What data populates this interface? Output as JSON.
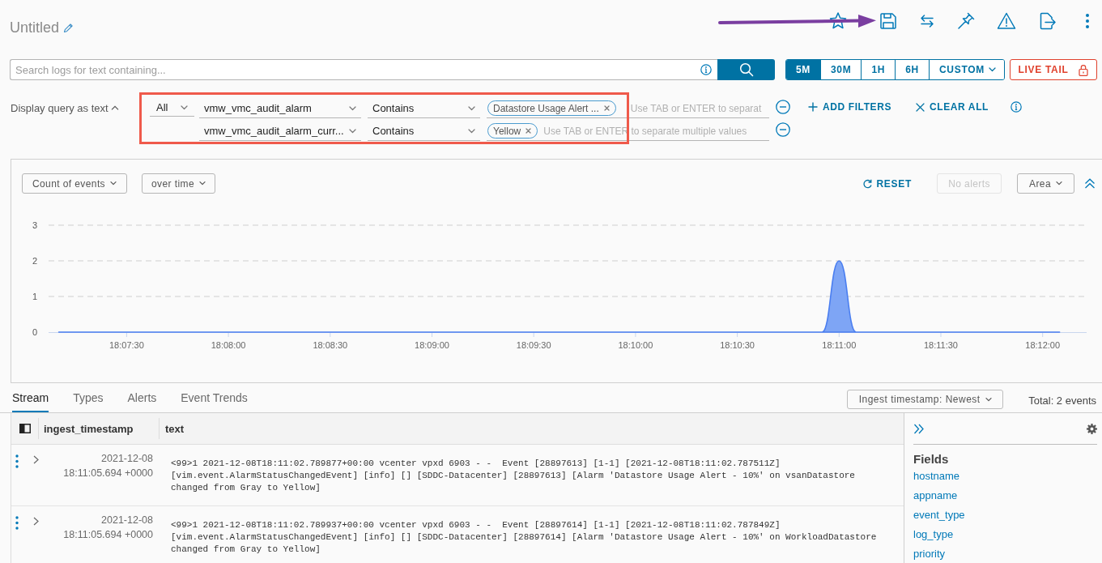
{
  "page": {
    "title": "Untitled"
  },
  "search": {
    "placeholder": "Search logs for text containing..."
  },
  "time_ranges": [
    {
      "label": "5M",
      "kind": "preset",
      "selected": true
    },
    {
      "label": "30M",
      "kind": "preset",
      "selected": false
    },
    {
      "label": "1H",
      "kind": "preset",
      "selected": false
    },
    {
      "label": "6H",
      "kind": "preset",
      "selected": false
    },
    {
      "label": "CUSTOM",
      "kind": "dropdown",
      "selected": false
    }
  ],
  "live_tail": {
    "label": "LIVE TAIL"
  },
  "query": {
    "toggle_label": "Display query as text",
    "expanded": true,
    "match": "All",
    "filters": [
      {
        "field": "vmw_vmc_audit_alarm",
        "operator": "Contains",
        "values": [
          "Datastore Usage Alert ..."
        ],
        "placeholder": "Use TAB or ENTER to separat"
      },
      {
        "field": "vmw_vmc_audit_alarm_curr...",
        "operator": "Contains",
        "values": [
          "Yellow"
        ],
        "placeholder": "Use TAB or ENTER to separate multiple values"
      }
    ],
    "actions": [
      {
        "kind": "add",
        "label": "ADD FILTERS"
      },
      {
        "kind": "clear",
        "label": "CLEAR ALL"
      }
    ]
  },
  "chart_panel": {
    "metric": "Count of events",
    "grouping": "over time",
    "reset_label": "RESET",
    "alerts": {
      "label": "No alerts",
      "disabled": true
    },
    "chart_type": "Area",
    "chart_data": {
      "type": "area",
      "categories": [
        null,
        null,
        null,
        null,
        "18:07:30",
        null,
        null,
        null,
        null,
        null,
        "18:08:00",
        null,
        null,
        null,
        null,
        null,
        "18:08:30",
        null,
        null,
        null,
        null,
        null,
        "18:09:00",
        null,
        null,
        null,
        null,
        null,
        "18:09:30",
        null,
        null,
        null,
        null,
        null,
        "18:10:00",
        null,
        null,
        null,
        null,
        null,
        "18:10:30",
        null,
        null,
        null,
        null,
        null,
        "18:11:00",
        null,
        null,
        null,
        null,
        null,
        "18:11:30",
        null,
        null,
        null,
        null,
        null,
        "18:12:00",
        null
      ],
      "values": [
        0,
        0,
        0,
        0,
        0,
        0,
        0,
        0,
        0,
        0,
        0,
        0,
        0,
        0,
        0,
        0,
        0,
        0,
        0,
        0,
        0,
        0,
        0,
        0,
        0,
        0,
        0,
        0,
        0,
        0,
        0,
        0,
        0,
        0,
        0,
        0,
        0,
        0,
        0,
        0,
        0,
        0,
        0,
        0,
        0,
        0,
        2,
        0,
        0,
        0,
        0,
        0,
        0,
        0,
        0,
        0,
        0,
        0,
        0,
        0
      ],
      "ylim": [
        0,
        3
      ],
      "yticks": [
        0,
        1,
        2,
        3
      ]
    }
  },
  "tabs": [
    {
      "label": "Stream",
      "selected": true
    },
    {
      "label": "Types",
      "selected": false
    },
    {
      "label": "Alerts",
      "selected": false
    },
    {
      "label": "Event Trends",
      "selected": false
    }
  ],
  "sort": "Ingest timestamp: Newest",
  "total": "Total: 2 events",
  "table": {
    "columns": [
      "ingest_timestamp",
      "text"
    ],
    "rows": [
      {
        "date": "2021-12-08",
        "time": "18:11:05.694 +0000",
        "text": "<99>1 2021-12-08T18:11:02.789877+00:00 vcenter vpxd 6903 - -  Event [28897613] [1-1] [2021-12-08T18:11:02.787511Z] [vim.event.AlarmStatusChangedEvent] [info] [] [SDDC-Datacenter] [28897613] [Alarm 'Datastore Usage Alert - 10%' on vsanDatastore changed from Gray to Yellow]"
      },
      {
        "date": "2021-12-08",
        "time": "18:11:05.694 +0000",
        "text": "<99>1 2021-12-08T18:11:02.789937+00:00 vcenter vpxd 6903 - -  Event [28897614] [1-1] [2021-12-08T18:11:02.787849Z] [vim.event.AlarmStatusChangedEvent] [info] [] [SDDC-Datacenter] [28897614] [Alarm 'Datastore Usage Alert - 10%' on WorkloadDatastore changed from Gray to Yellow]"
      }
    ]
  },
  "fields_panel": {
    "title": "Fields",
    "items": [
      "hostname",
      "appname",
      "event_type",
      "log_type",
      "priority"
    ]
  },
  "annotations": [
    {
      "kind": "arrow"
    },
    {
      "kind": "frame"
    }
  ]
}
